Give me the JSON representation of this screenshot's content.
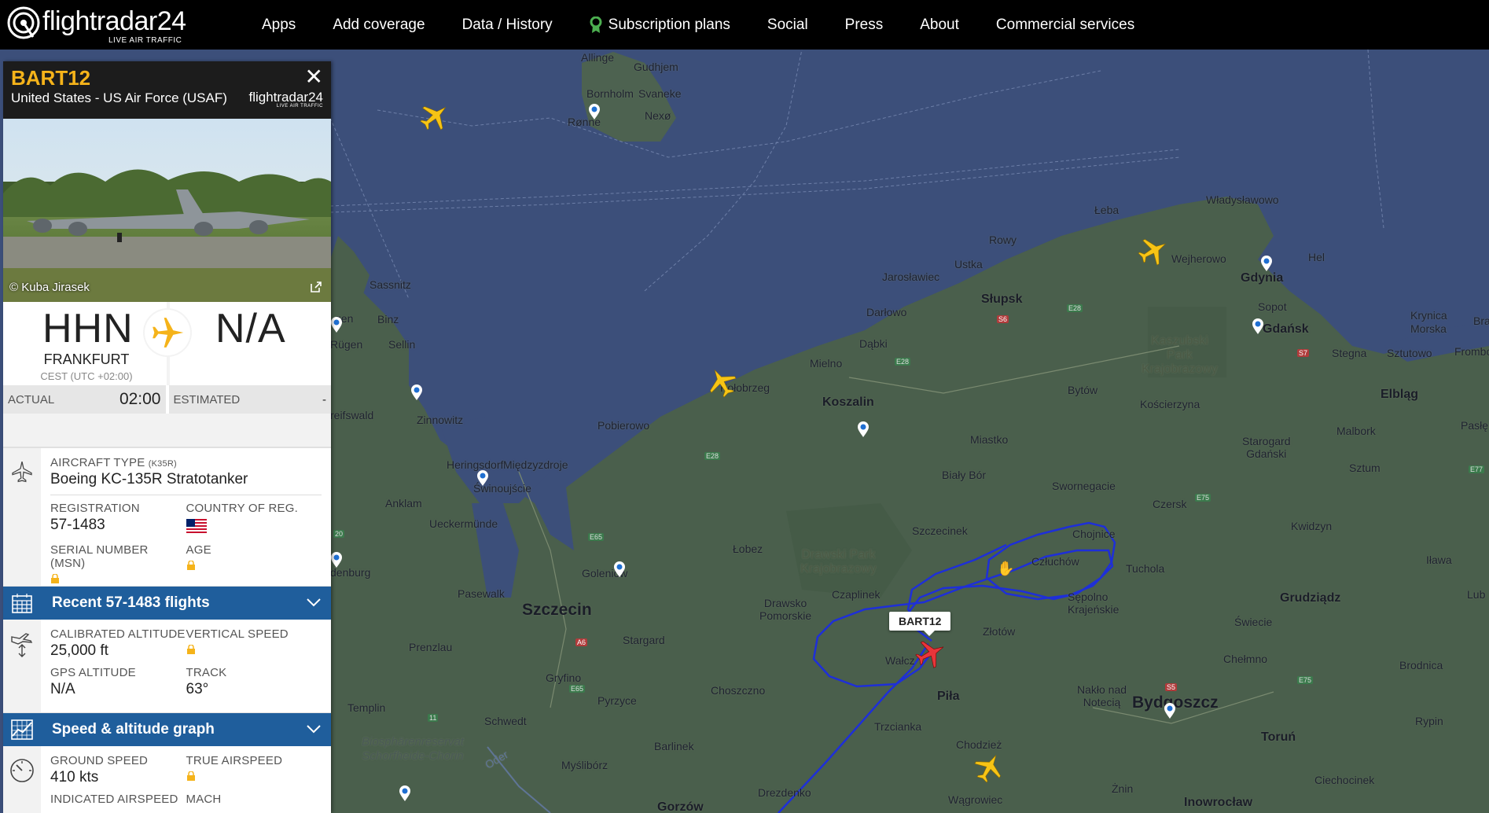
{
  "brand": {
    "wordmark": "flightradar24",
    "tagline": "LIVE AIR TRAFFIC"
  },
  "nav": {
    "items": [
      {
        "label": "Apps"
      },
      {
        "label": "Add coverage"
      },
      {
        "label": "Data / History"
      },
      {
        "label": "Subscription plans",
        "icon": "award-ribbon-icon"
      },
      {
        "label": "Social"
      },
      {
        "label": "Press"
      },
      {
        "label": "About"
      },
      {
        "label": "Commercial services"
      }
    ]
  },
  "flight": {
    "callsign": "BART12",
    "operator": "United States - US Air Force (USAF)",
    "panel_logo": "flightradar24",
    "panel_logo_tagline": "LIVE AIR TRAFFIC",
    "photo_credit": "© Kuba Jirasek",
    "origin": {
      "code": "HHN",
      "city": "FRANKFURT",
      "tz": "CEST (UTC +02:00)"
    },
    "destination": {
      "code": "N/A"
    },
    "actual_label": "ACTUAL",
    "actual_time": "02:00",
    "estimated_label": "ESTIMATED",
    "estimated_time": "-",
    "aircraft_type_label": "AIRCRAFT TYPE",
    "aircraft_type_code": "(K35R)",
    "aircraft_type": "Boeing KC-135R Stratotanker",
    "registration_label": "REGISTRATION",
    "registration": "57-1483",
    "country_label": "COUNTRY OF REG.",
    "serial_label": "SERIAL NUMBER (MSN)",
    "age_label": "AGE",
    "recent_flights_label": "Recent 57-1483 flights",
    "calibrated_alt_label": "CALIBRATED ALTITUDE",
    "calibrated_alt": "25,000 ft",
    "vertical_speed_label": "VERTICAL SPEED",
    "gps_alt_label": "GPS ALTITUDE",
    "gps_alt": "N/A",
    "track_label": "TRACK",
    "track": "63°",
    "graph_label": "Speed & altitude graph",
    "ground_speed_label": "GROUND SPEED",
    "ground_speed": "410 kts",
    "true_airspeed_label": "TRUE AIRSPEED",
    "indicated_airspeed_label": "INDICATED AIRSPEED",
    "mach_label": "MACH"
  },
  "map": {
    "callout": "BART12",
    "labels": {
      "allinge": "Allinge",
      "gudhjem": "Gudhjem",
      "bornholm": "Bornholm",
      "svaneke": "Svaneke",
      "ronne": "Rønne",
      "nexo": "Nexø",
      "leba": "Łeba",
      "wladyslawowo": "Władysławowo",
      "rowy": "Rowy",
      "ustka": "Ustka",
      "jaroslawiec": "Jarosławiec",
      "wejherowo": "Wejherowo",
      "hel": "Hel",
      "gdynia": "Gdynia",
      "sopot": "Sopot",
      "gdansk": "Gdańsk",
      "slupsk": "Słupsk",
      "darlowo": "Darłowo",
      "dabki": "Dąbki",
      "kaszubski": "Kaszubski\nPark\nKrajobrazowy",
      "krynica": "Krynica\nMorska",
      "stegna": "Stegna",
      "sztutowo": "Sztutowo",
      "frombo": "Frombo",
      "sassnitz": "Sassnitz",
      "binz": "Binz",
      "sellin": "Sellin",
      "gen": "gen",
      "rugen": "Rügen",
      "mielno": "Mielno",
      "kolobrzeg": "Kołobrzeg",
      "koszalin": "Koszalin",
      "bytow": "Bytów",
      "koscierzyna": "Kościerzyna",
      "elblag": "Elbląg",
      "pasleka": "Pasłęk",
      "starogard": "Starogard\nGdański",
      "malbork": "Malbork",
      "reifswald": "reifswald",
      "zinnowitz": "Zinnowitz",
      "pobierowo": "Pobierowo",
      "miastko": "Miastko",
      "heringsdorf": "Heringsdorf",
      "miedzyzdroje": "Międzyzdroje",
      "swinoujscie": "Świnoujście",
      "bialybor": "Biały Bór",
      "swornegacie": "Swornegacie",
      "sztum": "Sztum",
      "czersk": "Czersk",
      "anklam": "Anklam",
      "ueckermunde": "Ueckermünde",
      "szczecinek": "Szczecinek",
      "chojnice": "Chojnice",
      "kwidzyn": "Kwidzyn",
      "ilawa": "Iława",
      "lobez": "Łobez",
      "drawski": "Drawski Park\nKrajobrazowy",
      "czluchow": "Człuchów",
      "tuchola": "Tuchola",
      "denburg": "denburg",
      "goleniow": "Goleniów",
      "pasewalk": "Pasewalk",
      "czaplinek": "Czaplinek",
      "sepolno": "Sępolno\nKrajeńskie",
      "grudziadz": "Grudziądz",
      "szczecin": "Szczecin",
      "drawsko": "Drawsko\nPomorskie",
      "stargard": "Stargard",
      "zlotow": "Złotów",
      "swiecie": "Świecie",
      "prenzlau": "Prenzlau",
      "walcz": "Wałcz",
      "chelmno": "Chełmno",
      "brodnica": "Brodnica",
      "gryfino": "Gryfino",
      "choszczno": "Choszczno",
      "pila": "Piła",
      "naklo": "Nakło nad\nNotecią",
      "bydgoszcz": "Bydgoszcz",
      "templin": "Templin",
      "pyrzyce": "Pyrzyce",
      "schwedt": "Schwedt",
      "trzcianka": "Trzcianka",
      "rypin": "Rypin",
      "biospharen": "Biosphärenreservat\nSchorfheide-Chorin",
      "barlinek": "Barlinek",
      "chodziez": "Chodzież",
      "torun": "Toruń",
      "mysliborz": "Myślibórz",
      "ciechocinek": "Ciechocinek",
      "znin": "Żnin",
      "drezdenko": "Drezdenko",
      "wagrowiec": "Wągrowiec",
      "inowroclaw": "Inowrocław",
      "gorzow": "Gorzów",
      "oder": "Oder",
      "lub": "Lub",
      "bra": "Bra",
      "e28a": "E28",
      "e28b": "E28",
      "e28c": "E28",
      "s6": "S6",
      "s7": "S7",
      "e77": "E77",
      "e75a": "E75",
      "e75b": "E75",
      "e65a": "E65",
      "e65b": "E65",
      "a6": "A6",
      "s5": "S5",
      "r20": "20",
      "r11": "11"
    }
  }
}
